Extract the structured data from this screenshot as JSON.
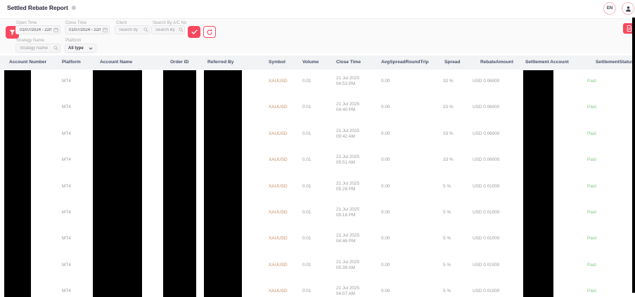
{
  "page": {
    "title": "Settled Rebate Report"
  },
  "topbar": {
    "language_label": "EN"
  },
  "filters": {
    "open_time": {
      "label": "Open Time",
      "value": "01/07/2024 - 22/0"
    },
    "close_time": {
      "label": "Close Time",
      "value": "01/07/2024 - 22/0"
    },
    "client": {
      "label": "Client",
      "placeholder": "Search by"
    },
    "search_ac_no": {
      "label": "Search By A/C No",
      "placeholder": "Search By"
    },
    "strategy": {
      "label": "Strategy Name",
      "placeholder": "Strategy Name"
    },
    "platform": {
      "label": "Platform",
      "value": "All type"
    }
  },
  "table": {
    "columns": [
      "Account Number",
      "Platform",
      "Account Name",
      "Order ID",
      "Referred By",
      "Symbol",
      "Volume",
      "Close Time",
      "AvgSpreadRoundTrip",
      "Spread",
      "RebateAmount",
      "Settlement Account",
      "SettlementStatus"
    ],
    "redacted_columns": [
      "Account Number",
      "Account Name",
      "Order ID",
      "Referred By",
      "Settlement Account"
    ],
    "rows": [
      {
        "platform": "MT4",
        "symbol": "XAUUSD",
        "volume": "0.01",
        "close_date": "21 Jul 2025",
        "close_time": "04:53 PM",
        "avg_spread_round_trip": "0.00",
        "spread": "33 %",
        "rebate_amount": "USD 0.06000",
        "settlement_status": "Paid"
      },
      {
        "platform": "MT4",
        "symbol": "XAUUSD",
        "volume": "0.01",
        "close_date": "21 Jul 2025",
        "close_time": "04:40 PM",
        "avg_spread_round_trip": "0.00",
        "spread": "33 %",
        "rebate_amount": "USD 0.06000",
        "settlement_status": "Paid"
      },
      {
        "platform": "MT4",
        "symbol": "XAUUSD",
        "volume": "0.01",
        "close_date": "21 Jul 2025",
        "close_time": "09:42 AM",
        "avg_spread_round_trip": "0.00",
        "spread": "33 %",
        "rebate_amount": "USD 0.06000",
        "settlement_status": "Paid"
      },
      {
        "platform": "MT4",
        "symbol": "XAUUSD",
        "volume": "0.01",
        "close_date": "21 Jul 2025",
        "close_time": "05:51 AM",
        "avg_spread_round_trip": "0.00",
        "spread": "33 %",
        "rebate_amount": "USD 0.06000",
        "settlement_status": "Paid"
      },
      {
        "platform": "MT4",
        "symbol": "XAUUSD",
        "volume": "0.01",
        "close_date": "21 Jul 2025",
        "close_time": "05:28 PM",
        "avg_spread_round_trip": "0.00",
        "spread": "5 %",
        "rebate_amount": "USD 0.01000",
        "settlement_status": "Paid"
      },
      {
        "platform": "MT4",
        "symbol": "XAUUSD",
        "volume": "0.01",
        "close_date": "21 Jul 2025",
        "close_time": "05:16 PM",
        "avg_spread_round_trip": "0.00",
        "spread": "5 %",
        "rebate_amount": "USD 0.01000",
        "settlement_status": "Paid"
      },
      {
        "platform": "MT4",
        "symbol": "XAUUSD",
        "volume": "0.01",
        "close_date": "21 Jul 2025",
        "close_time": "04:46 PM",
        "avg_spread_round_trip": "0.00",
        "spread": "5 %",
        "rebate_amount": "USD 0.01000",
        "settlement_status": "Paid"
      },
      {
        "platform": "MT4",
        "symbol": "XAUUSD",
        "volume": "0.01",
        "close_date": "21 Jul 2025",
        "close_time": "05:39 AM",
        "avg_spread_round_trip": "0.00",
        "spread": "5 %",
        "rebate_amount": "USD 0.01000",
        "settlement_status": "Paid"
      },
      {
        "platform": "MT4",
        "symbol": "XAUUSD",
        "volume": "0.01",
        "close_date": "21 Jul 2025",
        "close_time": "04:07 AM",
        "avg_spread_round_trip": "0.00",
        "spread": "5 %",
        "rebate_amount": "USD 0.01000",
        "settlement_status": "Paid"
      }
    ]
  },
  "colors": {
    "accent": "#f8485e",
    "paid_green": "#85c985",
    "symbol_orange": "#c49167",
    "header_text": "#475069"
  }
}
